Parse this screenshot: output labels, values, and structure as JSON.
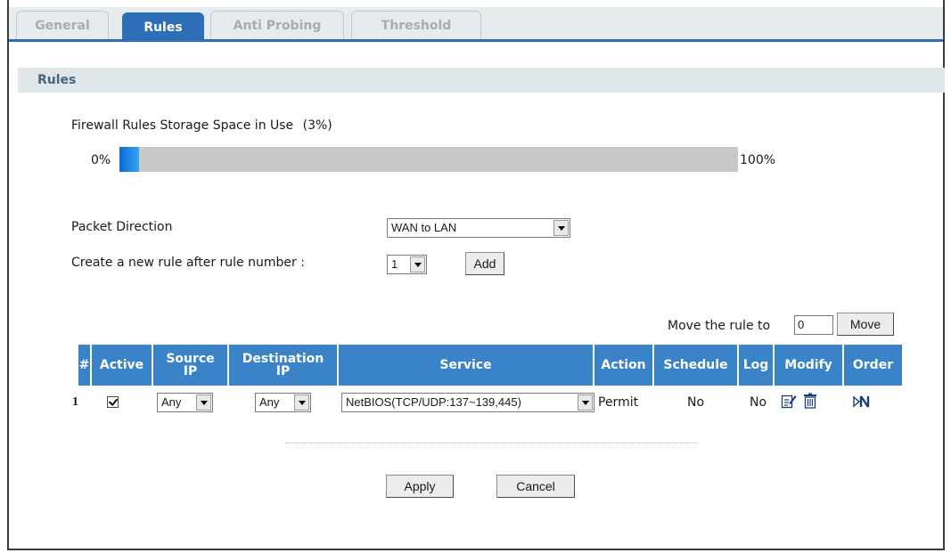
{
  "tabs": [
    {
      "label": "General",
      "active": false
    },
    {
      "label": "Rules",
      "active": true
    },
    {
      "label": "Anti Probing",
      "active": false
    },
    {
      "label": "Threshold",
      "active": false
    }
  ],
  "section": {
    "title": "Rules"
  },
  "storage": {
    "label": "Firewall Rules Storage Space in Use",
    "percent_text": "(3%)",
    "percent": 3,
    "min_label": "0%",
    "max_label": "100%"
  },
  "packet_direction": {
    "label": "Packet Direction",
    "value": "WAN to LAN"
  },
  "new_rule": {
    "label": "Create a new rule after rule number :",
    "value": "1",
    "add_label": "Add"
  },
  "move": {
    "label": "Move the rule to",
    "value": "0",
    "button_label": "Move"
  },
  "table": {
    "headers": {
      "num": "#",
      "active": "Active",
      "source_1": "Source",
      "source_2": "IP",
      "dest_1": "Destination",
      "dest_2": "IP",
      "service": "Service",
      "action": "Action",
      "schedule": "Schedule",
      "log": "Log",
      "modify": "Modify",
      "order": "Order"
    },
    "rows": [
      {
        "num": "1",
        "active": true,
        "source": "Any",
        "destination": "Any",
        "service": "NetBIOS(TCP/UDP:137~139,445)",
        "action": "Permit",
        "schedule": "No",
        "log": "No"
      }
    ]
  },
  "buttons": {
    "apply": "Apply",
    "cancel": "Cancel"
  },
  "colors": {
    "accent": "#2c6fb8",
    "header_bg": "#3a83c8",
    "section_bg": "#dfe6ea",
    "bar_fill": "#1a84e6"
  }
}
